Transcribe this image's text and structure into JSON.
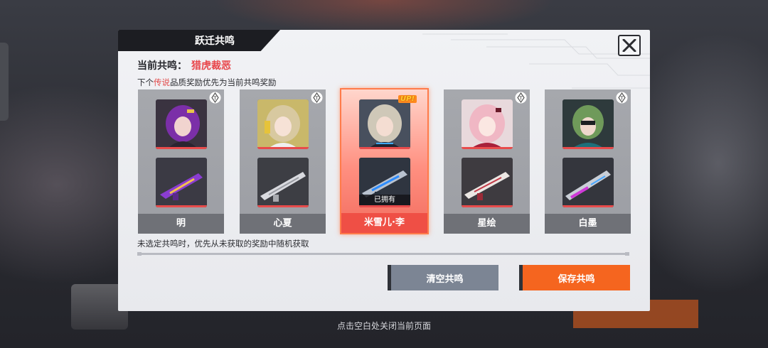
{
  "dialog": {
    "title": "跃迁共鸣",
    "current_label": "当前共鸣：",
    "current_value": "猎虎裁恶",
    "priority_prefix": "下个",
    "priority_legend": "传说",
    "priority_suffix": "品质奖励优先为当前共鸣奖励",
    "random_note": "未选定共鸣时，优先从未获取的奖励中随机获取",
    "close_hint": "点击空白处关闭当前页面"
  },
  "cards": [
    {
      "name": "明",
      "selected": false,
      "owned_label": "",
      "up": false
    },
    {
      "name": "心夏",
      "selected": false,
      "owned_label": "",
      "up": false
    },
    {
      "name": "米雪儿·李",
      "selected": true,
      "owned_label": "已拥有",
      "up": true,
      "up_label": "UP!"
    },
    {
      "name": "星绘",
      "selected": false,
      "owned_label": "",
      "up": false
    },
    {
      "name": "白墨",
      "selected": false,
      "owned_label": "",
      "up": false
    }
  ],
  "buttons": {
    "clear_label": "清空共鸣",
    "save_label": "保存共鸣"
  },
  "colors": {
    "accent": "#f5651f",
    "highlight_text": "#e8454a",
    "selected_card": "#ef4f45",
    "clear_button": "#7c8594"
  },
  "icons": [
    "close-icon",
    "tier-t-badge-icon",
    "up-badge"
  ]
}
